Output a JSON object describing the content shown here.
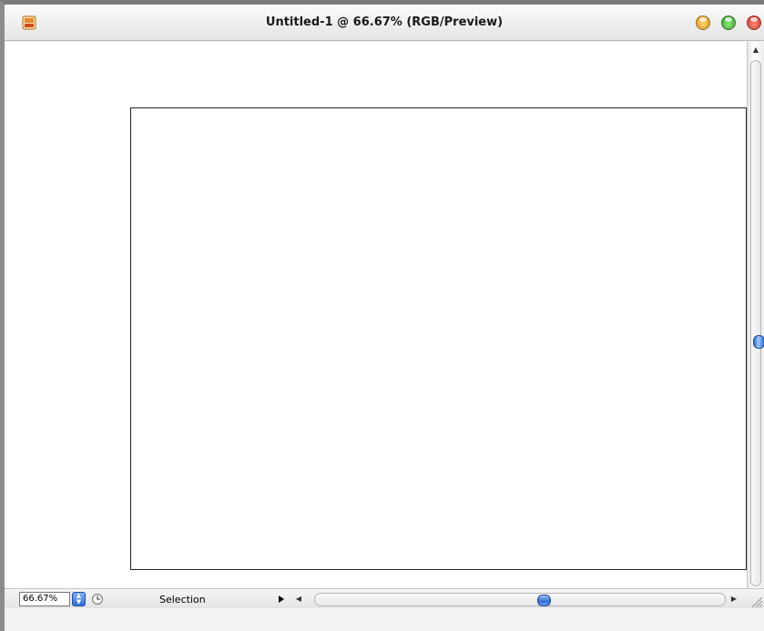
{
  "window": {
    "title": "Untitled-1 @ 66.67% (RGB/Preview)",
    "icons": {
      "app": "photoshop-document-icon",
      "minimize": "minimize-icon",
      "maximize": "zoom-icon",
      "close": "close-icon"
    }
  },
  "colors": {
    "accent": "#2f6ed0",
    "close": "#d8321f",
    "minimize": "#e99a13",
    "maximize": "#33a524"
  },
  "statusbar": {
    "zoom_value": "66.67%",
    "info_label": "Selection",
    "icons": {
      "zoom_stepper": "stepper-icon",
      "history": "clock-icon",
      "menu": "triangle-right-icon"
    }
  },
  "scrollbars": {
    "vertical_up": "▲",
    "vertical_down": "▼",
    "horizontal_left": "◀",
    "horizontal_right": "▶"
  }
}
